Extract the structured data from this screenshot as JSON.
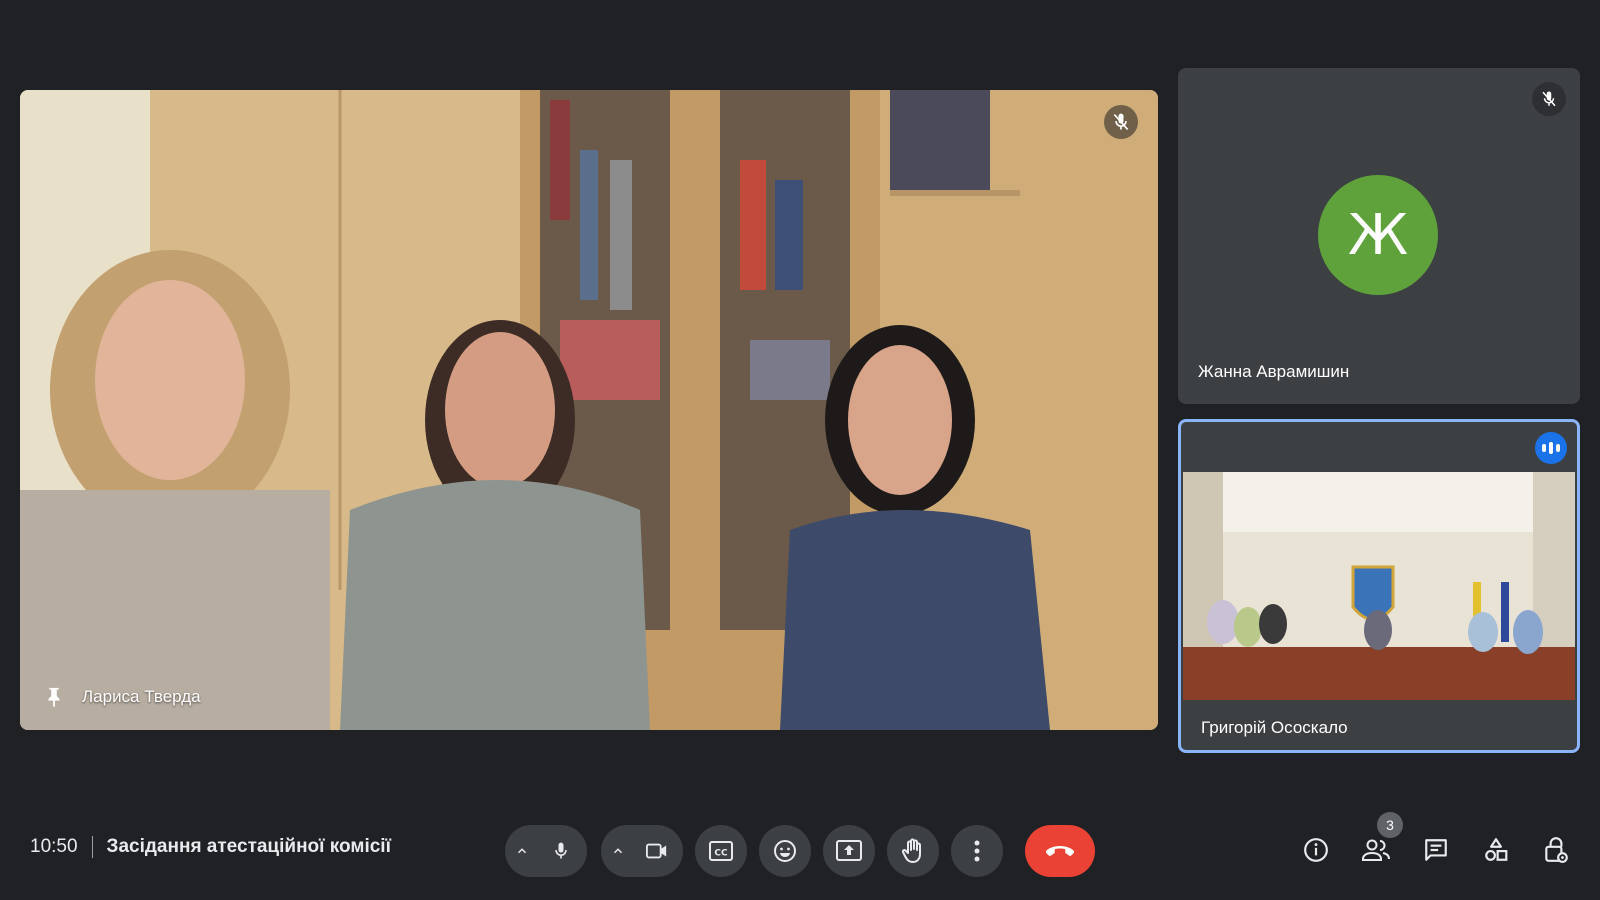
{
  "main_tile": {
    "participant_name": "Лариса Тверда",
    "pinned": true,
    "muted": true
  },
  "side_tiles": [
    {
      "participant_name": "Жанна Аврамишин",
      "avatar_letter": "Ж",
      "avatar_color": "#5fa23b",
      "muted": true,
      "video": false
    },
    {
      "participant_name": "Григорій Ососкало",
      "speaking": true,
      "active_border_color": "#8ab4f8",
      "video": true
    }
  ],
  "bottom_bar": {
    "time": "10:50",
    "meeting_title": "Засідання атестаційної комісії",
    "controls": [
      {
        "name": "microphone",
        "icon": "microphone-icon"
      },
      {
        "name": "camera",
        "icon": "camera-icon"
      },
      {
        "name": "captions",
        "icon": "captions-icon"
      },
      {
        "name": "reactions",
        "icon": "emoji-icon"
      },
      {
        "name": "present",
        "icon": "present-screen-icon"
      },
      {
        "name": "raise-hand",
        "icon": "hand-icon"
      },
      {
        "name": "more-options",
        "icon": "more-vert-icon"
      },
      {
        "name": "leave-call",
        "icon": "end-call-icon",
        "color": "#ea4335"
      }
    ],
    "right_icons": [
      "info-icon",
      "people-icon",
      "chat-icon",
      "activities-icon",
      "host-controls-icon"
    ],
    "participant_count": "3"
  },
  "colors": {
    "background": "#202124",
    "tile": "#3c4043",
    "end_call": "#ea4335",
    "speaking": "#1a73e8"
  }
}
